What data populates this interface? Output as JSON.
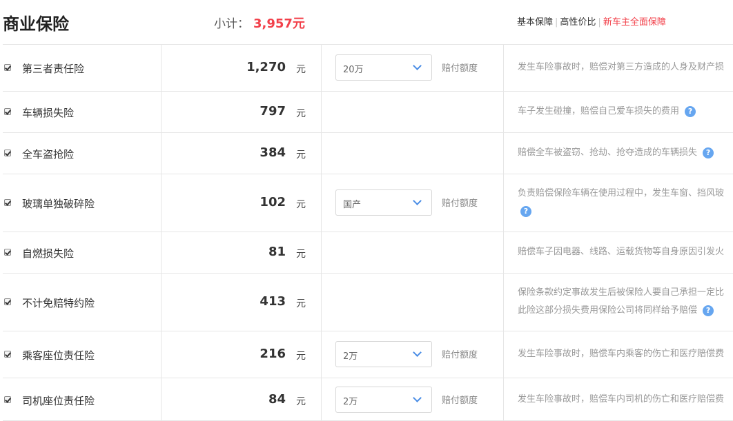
{
  "header": {
    "title": "商业保险",
    "subtotal_label": "小计：",
    "subtotal_amount": "3,957元",
    "plans": [
      "基本保障",
      "高性价比",
      "新车主全面保障"
    ],
    "active_plan_index": 2
  },
  "colors": {
    "accent_red": "#f2404a",
    "help_blue": "#66a6f0",
    "chevron_blue": "#4a8de6"
  },
  "unit": "元",
  "selector_label": "赔付额度",
  "help_icon": "?",
  "rows": [
    {
      "checked": true,
      "name": "第三者责任险",
      "price": "1,270",
      "select": "20万",
      "desc": [
        "发生车险事故时，赔偿对第三方造成的人身及财产损"
      ],
      "help": false
    },
    {
      "checked": true,
      "name": "车辆损失险",
      "price": "797",
      "select": null,
      "desc": [
        "车子发生碰撞，赔偿自己爱车损失的费用"
      ],
      "help": true
    },
    {
      "checked": true,
      "name": "全车盗抢险",
      "price": "384",
      "select": null,
      "desc": [
        "赔偿全车被盗窃、抢劫、抢夺造成的车辆损失"
      ],
      "help": true
    },
    {
      "checked": true,
      "name": "玻璃单独破碎险",
      "price": "102",
      "select": "国产",
      "desc": [
        "负责赔偿保险车辆在使用过程中，发生车窗、挡风玻",
        ""
      ],
      "help": true
    },
    {
      "checked": true,
      "name": "自燃损失险",
      "price": "81",
      "select": null,
      "desc": [
        "赔偿车子因电器、线路、运载货物等自身原因引发火"
      ],
      "help": false
    },
    {
      "checked": true,
      "name": "不计免赔特约险",
      "price": "413",
      "select": null,
      "desc": [
        "保险条款约定事故发生后被保险人要自己承担一定比",
        "此险这部分损失费用保险公司将同样给予赔偿"
      ],
      "help": true
    },
    {
      "checked": true,
      "name": "乘客座位责任险",
      "price": "216",
      "select": "2万",
      "desc": [
        "发生车险事故时，赔偿车内乘客的伤亡和医疗赔偿费"
      ],
      "help": false
    },
    {
      "checked": true,
      "name": "司机座位责任险",
      "price": "84",
      "select": "2万",
      "desc": [
        "发生车险事故时，赔偿车内司机的伤亡和医疗赔偿费"
      ],
      "help": false
    }
  ]
}
